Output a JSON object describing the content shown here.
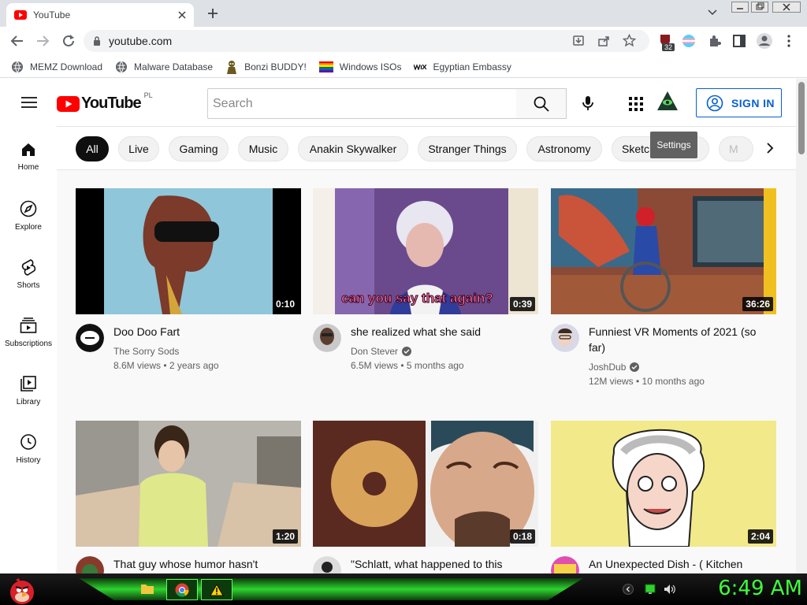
{
  "browser": {
    "tab_title": "YouTube",
    "url": "youtube.com",
    "extension_badge": "32",
    "bookmarks": [
      {
        "label": "MEMZ Download"
      },
      {
        "label": "Malware Database"
      },
      {
        "label": "Bonzi BUDDY!"
      },
      {
        "label": "Windows ISOs"
      },
      {
        "label": "Egyptian Embassy"
      }
    ]
  },
  "youtube": {
    "logo_text": "YouTube",
    "region": "PL",
    "search_placeholder": "Search",
    "sign_in_label": "SIGN IN",
    "settings_tooltip": "Settings",
    "sidebar": [
      {
        "label": "Home"
      },
      {
        "label": "Explore"
      },
      {
        "label": "Shorts"
      },
      {
        "label": "Subscriptions"
      },
      {
        "label": "Library"
      },
      {
        "label": "History"
      }
    ],
    "chips": [
      "All",
      "Live",
      "Gaming",
      "Music",
      "Anakin Skywalker",
      "Stranger Things",
      "Astronomy",
      "Sketch",
      "M"
    ],
    "videos": [
      {
        "title": "Doo Doo Fart",
        "channel": "The Sorry Sods",
        "meta": "8.6M views • 2 years ago",
        "duration": "0:10",
        "verified": false,
        "thumb_caption": ""
      },
      {
        "title": "she realized what she said",
        "channel": "Don Stever",
        "meta": "6.5M views • 5 months ago",
        "duration": "0:39",
        "verified": true,
        "thumb_caption": "can you say that again?"
      },
      {
        "title": "Funniest VR Moments of 2021 (so far)",
        "channel": "JoshDub",
        "meta": "12M views • 10 months ago",
        "duration": "36:26",
        "verified": true,
        "thumb_caption": ""
      },
      {
        "title": "That guy whose humor hasn't",
        "channel": "",
        "meta": "",
        "duration": "1:20",
        "verified": false,
        "thumb_caption": ""
      },
      {
        "title": "\"Schlatt, what happened to this",
        "channel": "",
        "meta": "",
        "duration": "0:18",
        "verified": false,
        "thumb_caption": ""
      },
      {
        "title": "An Unexpected Dish - ( Kitchen",
        "channel": "",
        "meta": "",
        "duration": "2:04",
        "verified": false,
        "thumb_caption": ""
      }
    ]
  },
  "taskbar": {
    "clock": "6:49 AM"
  },
  "colors": {
    "youtube_red": "#ff0000",
    "sign_in_blue": "#065fd4",
    "clock_green": "#3cff3c"
  }
}
